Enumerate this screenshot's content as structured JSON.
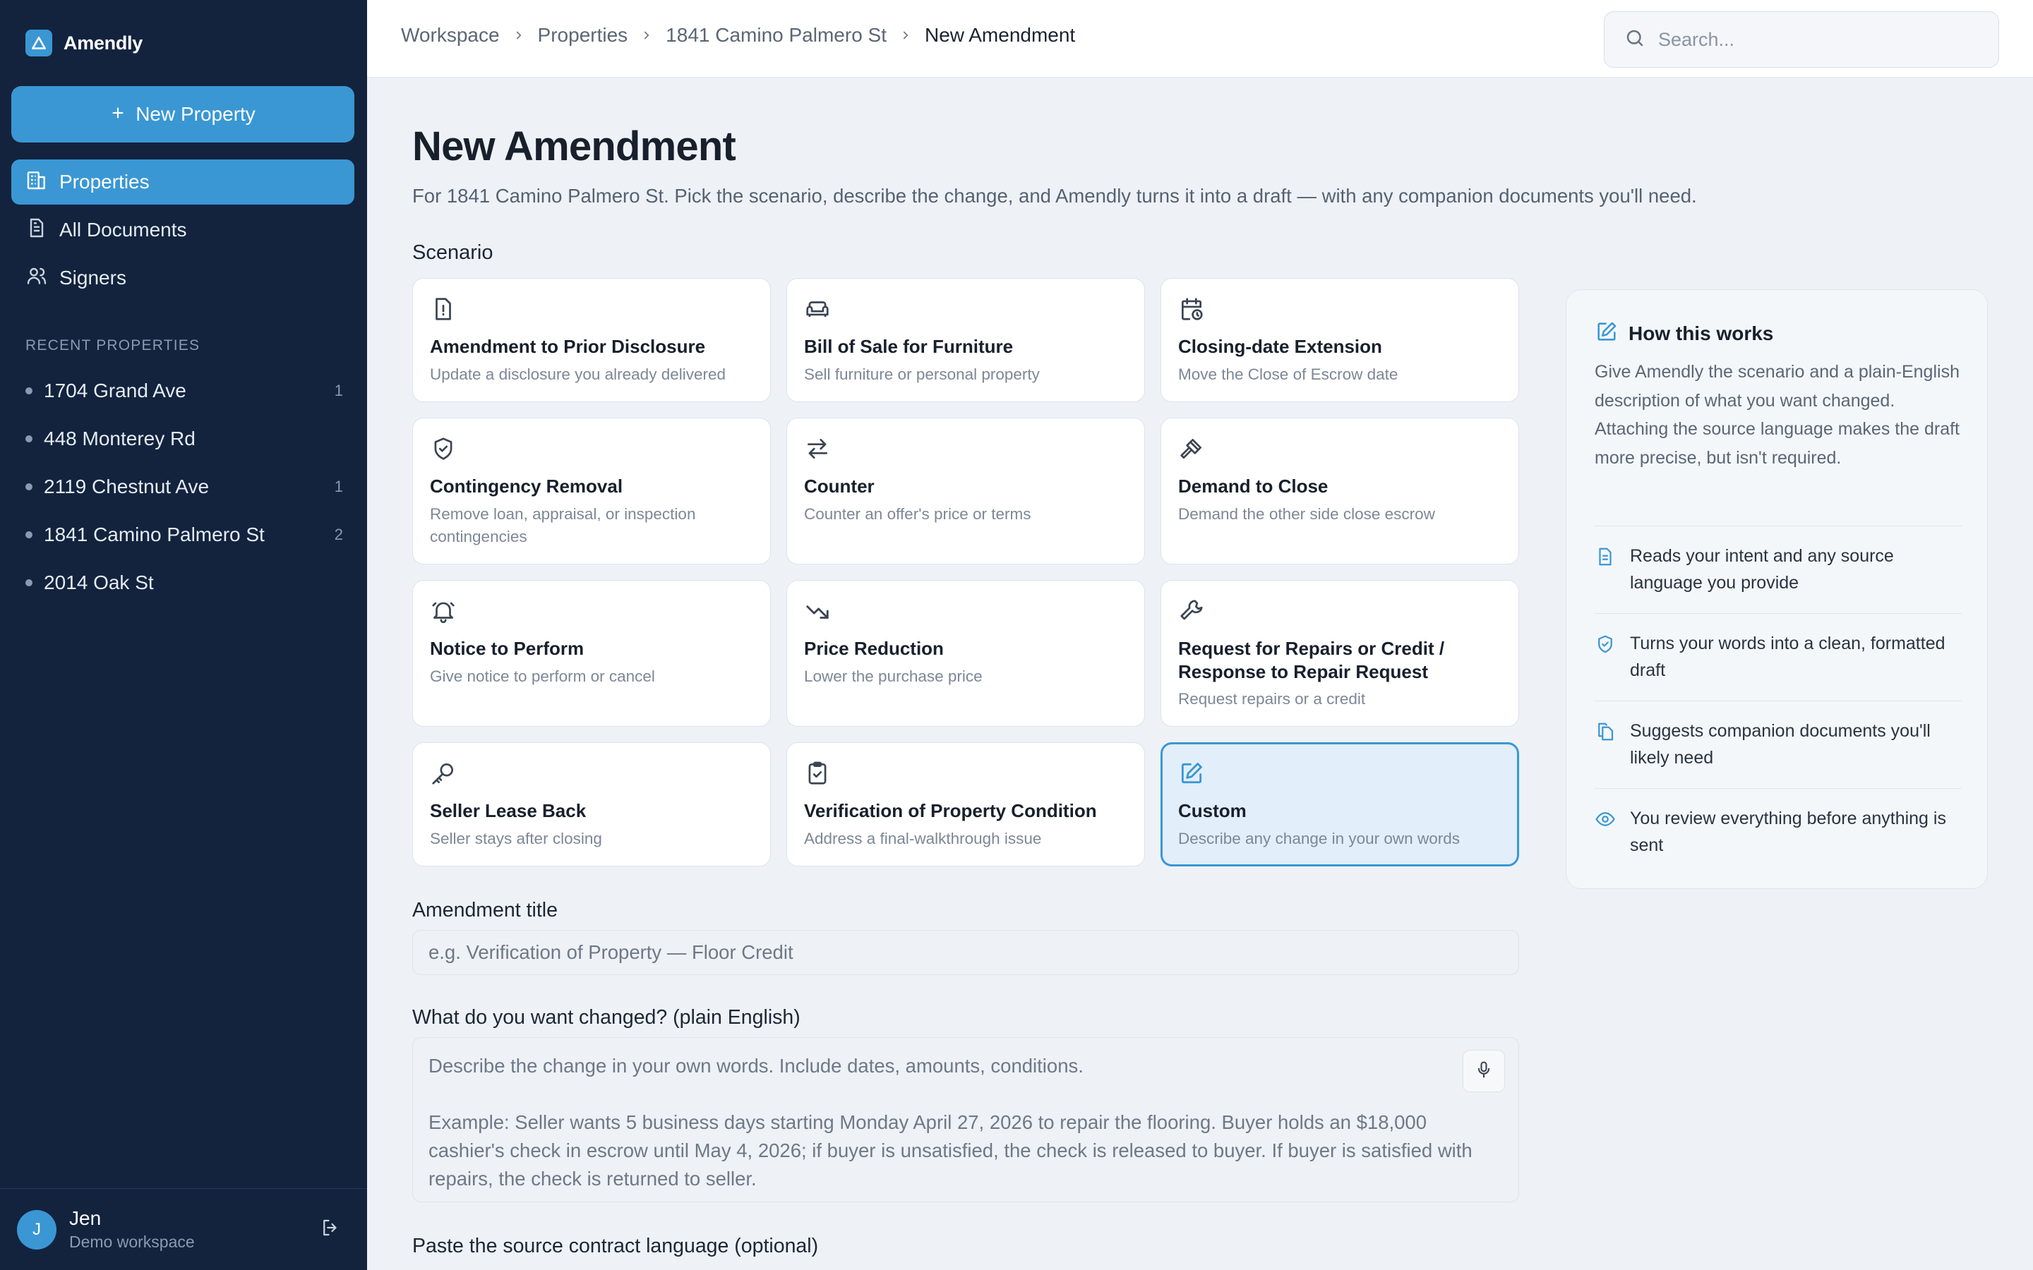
{
  "app": {
    "name": "Amendly"
  },
  "sidebar": {
    "new_property_label": "New Property",
    "nav": [
      {
        "label": "Properties",
        "icon": "building-icon",
        "active": true
      },
      {
        "label": "All Documents",
        "icon": "document-icon",
        "active": false
      },
      {
        "label": "Signers",
        "icon": "users-icon",
        "active": false
      }
    ],
    "recent_header": "RECENT PROPERTIES",
    "recent": [
      {
        "name": "1704 Grand Ave",
        "count": "1"
      },
      {
        "name": "448 Monterey Rd",
        "count": ""
      },
      {
        "name": "2119 Chestnut Ave",
        "count": "1"
      },
      {
        "name": "1841 Camino Palmero St",
        "count": "2"
      },
      {
        "name": "2014 Oak St",
        "count": ""
      }
    ],
    "user": {
      "initial": "J",
      "name": "Jen",
      "workspace": "Demo workspace"
    }
  },
  "topbar": {
    "breadcrumb": [
      "Workspace",
      "Properties",
      "1841 Camino Palmero St",
      "New Amendment"
    ],
    "search_placeholder": "Search..."
  },
  "main": {
    "title": "New Amendment",
    "subtitle": "For 1841 Camino Palmero St. Pick the scenario, describe the change, and Amendly turns it into a draft — with any companion documents you'll need.",
    "scenario_label": "Scenario",
    "scenarios": [
      {
        "title": "Amendment to Prior Disclosure",
        "desc": "Update a disclosure you already delivered",
        "icon": "disclosure-icon"
      },
      {
        "title": "Bill of Sale for Furniture",
        "desc": "Sell furniture or personal property",
        "icon": "sofa-icon"
      },
      {
        "title": "Closing-date Extension",
        "desc": "Move the Close of Escrow date",
        "icon": "calendar-clock-icon"
      },
      {
        "title": "Contingency Removal",
        "desc": "Remove loan, appraisal, or inspection contingencies",
        "icon": "shield-check-icon"
      },
      {
        "title": "Counter",
        "desc": "Counter an offer's price or terms",
        "icon": "arrows-swap-icon"
      },
      {
        "title": "Demand to Close",
        "desc": "Demand the other side close escrow",
        "icon": "gavel-icon"
      },
      {
        "title": "Notice to Perform",
        "desc": "Give notice to perform or cancel",
        "icon": "bell-icon"
      },
      {
        "title": "Price Reduction",
        "desc": "Lower the purchase price",
        "icon": "trending-down-icon"
      },
      {
        "title": "Request for Repairs or Credit / Response to Repair Request",
        "desc": "Request repairs or a credit",
        "icon": "wrench-icon"
      },
      {
        "title": "Seller Lease Back",
        "desc": "Seller stays after closing",
        "icon": "key-icon"
      },
      {
        "title": "Verification of Property Condition",
        "desc": "Address a final-walkthrough issue",
        "icon": "clipboard-check-icon"
      },
      {
        "title": "Custom",
        "desc": "Describe any change in your own words",
        "icon": "pencil-square-icon",
        "selected": true
      }
    ],
    "amendment_title_label": "Amendment title",
    "amendment_title_placeholder": "e.g. Verification of Property — Floor Credit",
    "change_label": "What do you want changed? (plain English)",
    "change_placeholder": "Describe the change in your own words. Include dates, amounts, conditions.\n\nExample: Seller wants 5 business days starting Monday April 27, 2026 to repair the flooring. Buyer holds an $18,000 cashier's check in escrow until May 4, 2026; if buyer is unsatisfied, the check is released to buyer. If buyer is satisfied with repairs, the check is returned to seller.",
    "source_label": "Paste the source contract language (optional)"
  },
  "how": {
    "title": "How this works",
    "body": "Give Amendly the scenario and a plain-English description of what you want changed. Attaching the source language makes the draft more precise, but isn't required.",
    "items": [
      {
        "text": "Reads your intent and any source language you provide",
        "icon": "document-icon"
      },
      {
        "text": "Turns your words into a clean, formatted draft",
        "icon": "shield-check-icon"
      },
      {
        "text": "Suggests companion documents you'll likely need",
        "icon": "copy-icon"
      },
      {
        "text": "You review everything before anything is sent",
        "icon": "eye-icon"
      }
    ]
  },
  "colors": {
    "sidebar": "#13233d",
    "accent": "#3a97d4",
    "page": "#eef2f7"
  }
}
